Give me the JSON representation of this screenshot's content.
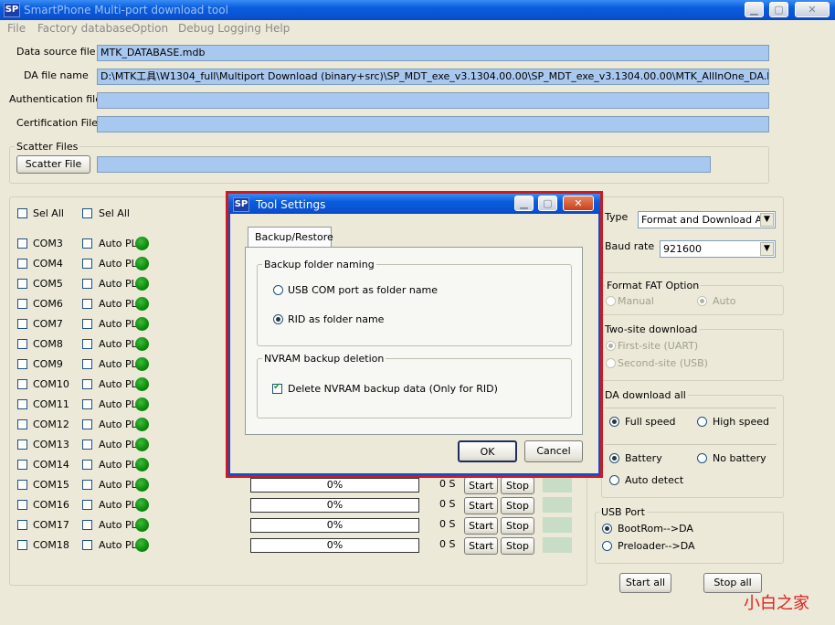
{
  "window": {
    "title": "SmartPhone Multi-port download tool",
    "icon_text": "SP",
    "controls": [
      "minimize",
      "maximize",
      "close"
    ]
  },
  "menu": [
    "File",
    "Factory database",
    "Option",
    "Debug Logging",
    "Help"
  ],
  "files": {
    "data_source_label": "Data source file",
    "data_source_value": "MTK_DATABASE.mdb",
    "da_label": "DA file name",
    "da_value": "D:\\MTK工具\\W1304_full\\Multiport Download (binary+src)\\SP_MDT_exe_v3.1304.00.00\\SP_MDT_exe_v3.1304.00.00\\MTK_AllInOne_DA.bin",
    "auth_label": "Authentication file",
    "auth_value": "",
    "cert_label": "Certification File",
    "cert_value": ""
  },
  "scatter": {
    "group_title": "Scatter Files",
    "button": "Scatter File",
    "value": ""
  },
  "ports": {
    "sel_all_1": "Sel All",
    "sel_all_2": "Sel All",
    "auto_label": "Auto PL",
    "rows": [
      {
        "com": "COM3"
      },
      {
        "com": "COM4"
      },
      {
        "com": "COM5"
      },
      {
        "com": "COM6"
      },
      {
        "com": "COM7"
      },
      {
        "com": "COM8"
      },
      {
        "com": "COM9"
      },
      {
        "com": "COM10"
      },
      {
        "com": "COM11"
      },
      {
        "com": "COM12"
      },
      {
        "com": "COM13"
      },
      {
        "com": "COM14"
      },
      {
        "com": "COM15",
        "progress": "0%",
        "time": "0 S",
        "start": "Start",
        "stop": "Stop"
      },
      {
        "com": "COM16",
        "progress": "0%",
        "time": "0 S",
        "start": "Start",
        "stop": "Stop"
      },
      {
        "com": "COM17",
        "progress": "0%",
        "time": "0 S",
        "start": "Start",
        "stop": "Stop"
      },
      {
        "com": "COM18",
        "progress": "0%",
        "time": "0 S",
        "start": "Start",
        "stop": "Stop"
      }
    ]
  },
  "right_panel": {
    "type_label": "Type",
    "type_value": "Format and Download All",
    "baud_label": "Baud rate",
    "baud_value": "921600",
    "format_fat": {
      "title": "Format FAT Option",
      "manual": "Manual",
      "auto": "Auto"
    },
    "two_site": {
      "title": "Two-site download",
      "first": "First-site (UART)",
      "second": "Second-site (USB)"
    },
    "da_download": {
      "title": "DA download all",
      "full": "Full speed",
      "high": "High speed",
      "battery": "Battery",
      "no_battery": "No battery",
      "auto_detect": "Auto detect"
    },
    "usb_port": {
      "title": "USB Port",
      "bootrom": "BootRom-->DA",
      "preloader": "Preloader-->DA"
    },
    "start_all": "Start all",
    "stop_all": "Stop all"
  },
  "dialog": {
    "title": "Tool Settings",
    "tab": "Backup/Restore",
    "naming_group": "Backup folder naming",
    "opt_usb": "USB COM port as folder name",
    "opt_rid": "RID as folder name",
    "nvram_group": "NVRAM backup deletion",
    "nvram_check": "Delete NVRAM backup data (Only for RID)",
    "ok": "OK",
    "cancel": "Cancel"
  },
  "watermark": "小白之家",
  "colors": {
    "field_bg": "#a9c8ef",
    "led": "#109010",
    "title_bar": "#0a5ddc",
    "dialog_border": "#d0191c"
  }
}
